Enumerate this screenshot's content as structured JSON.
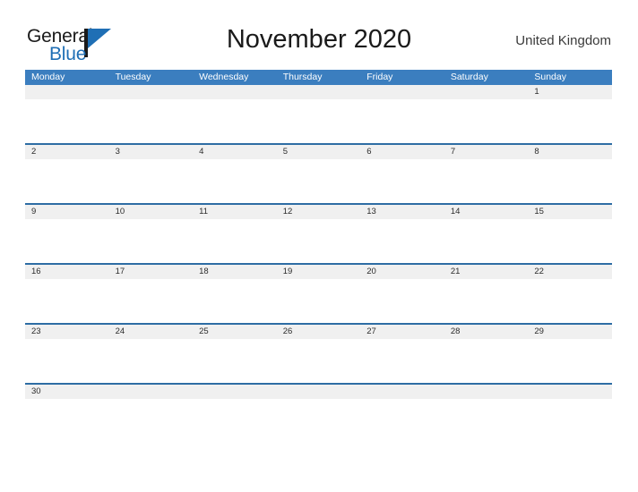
{
  "brand": {
    "name_part1": "General",
    "name_part2": "Blue",
    "mark_icon": "triangle-flag-icon",
    "color_dark": "#1a1a1a",
    "color_blue": "#1f6fb5"
  },
  "header": {
    "title": "November 2020",
    "country": "United Kingdom"
  },
  "colors": {
    "header_blue": "#3b7ebf",
    "rule_blue": "#2e6da4",
    "band_gray": "#f0f0f0",
    "page_background": "#ffffff",
    "text": "#2b2b2b"
  },
  "calendar": {
    "month": "November",
    "year": "2020",
    "week_start": "Monday",
    "weekdays": [
      "Monday",
      "Tuesday",
      "Wednesday",
      "Thursday",
      "Friday",
      "Saturday",
      "Sunday"
    ],
    "weeks": [
      [
        "",
        "",
        "",
        "",
        "",
        "",
        "1"
      ],
      [
        "2",
        "3",
        "4",
        "5",
        "6",
        "7",
        "8"
      ],
      [
        "9",
        "10",
        "11",
        "12",
        "13",
        "14",
        "15"
      ],
      [
        "16",
        "17",
        "18",
        "19",
        "20",
        "21",
        "22"
      ],
      [
        "23",
        "24",
        "25",
        "26",
        "27",
        "28",
        "29"
      ],
      [
        "30",
        "",
        "",
        "",
        "",
        "",
        ""
      ]
    ]
  }
}
